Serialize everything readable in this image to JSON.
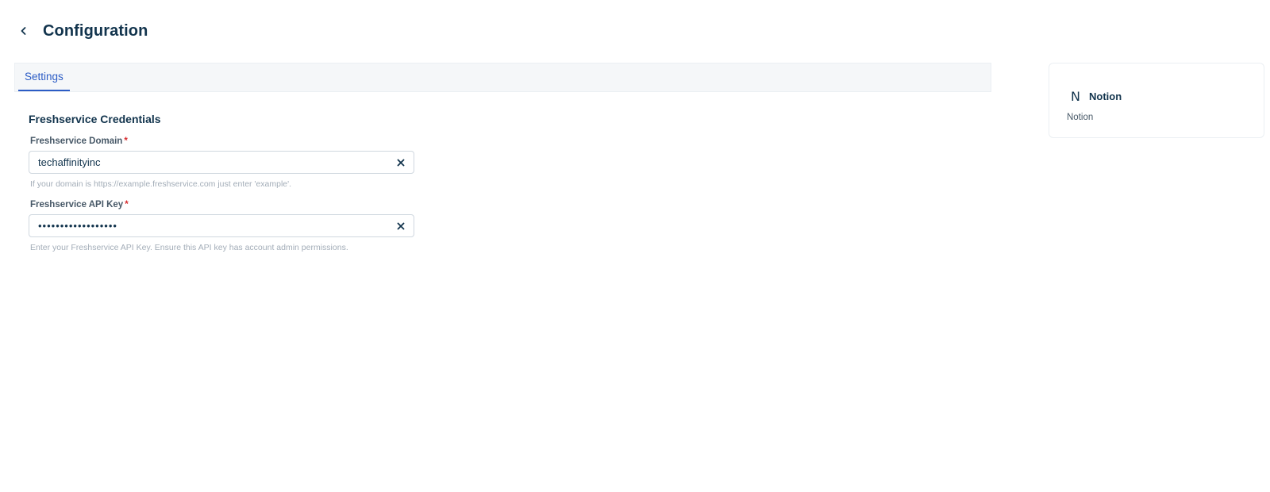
{
  "header": {
    "back_icon": "chevron-left-icon",
    "title": "Configuration"
  },
  "tabs": [
    {
      "label": "Settings",
      "active": true
    }
  ],
  "form": {
    "section_title": "Freshservice Credentials",
    "fields": [
      {
        "label": "Freshservice Domain",
        "required_mark": "*",
        "value": "techaffinityinc",
        "type": "text",
        "hint": "If your domain is https://example.freshservice.com just enter 'example'."
      },
      {
        "label": "Freshservice API Key",
        "required_mark": "*",
        "value": "••••••••••••••••••",
        "type": "password",
        "hint": "Enter your Freshservice API Key. Ensure this API key has account admin permissions."
      }
    ],
    "clear_icon": "close-icon"
  },
  "card": {
    "logo_letter": "N",
    "title": "Notion",
    "subtitle": "Notion"
  },
  "colors": {
    "accent": "#2c5cc5",
    "text_primary": "#12344d",
    "required": "#d72d30",
    "hint": "#a3adb8",
    "tabbar_bg": "#f5f7f9"
  }
}
